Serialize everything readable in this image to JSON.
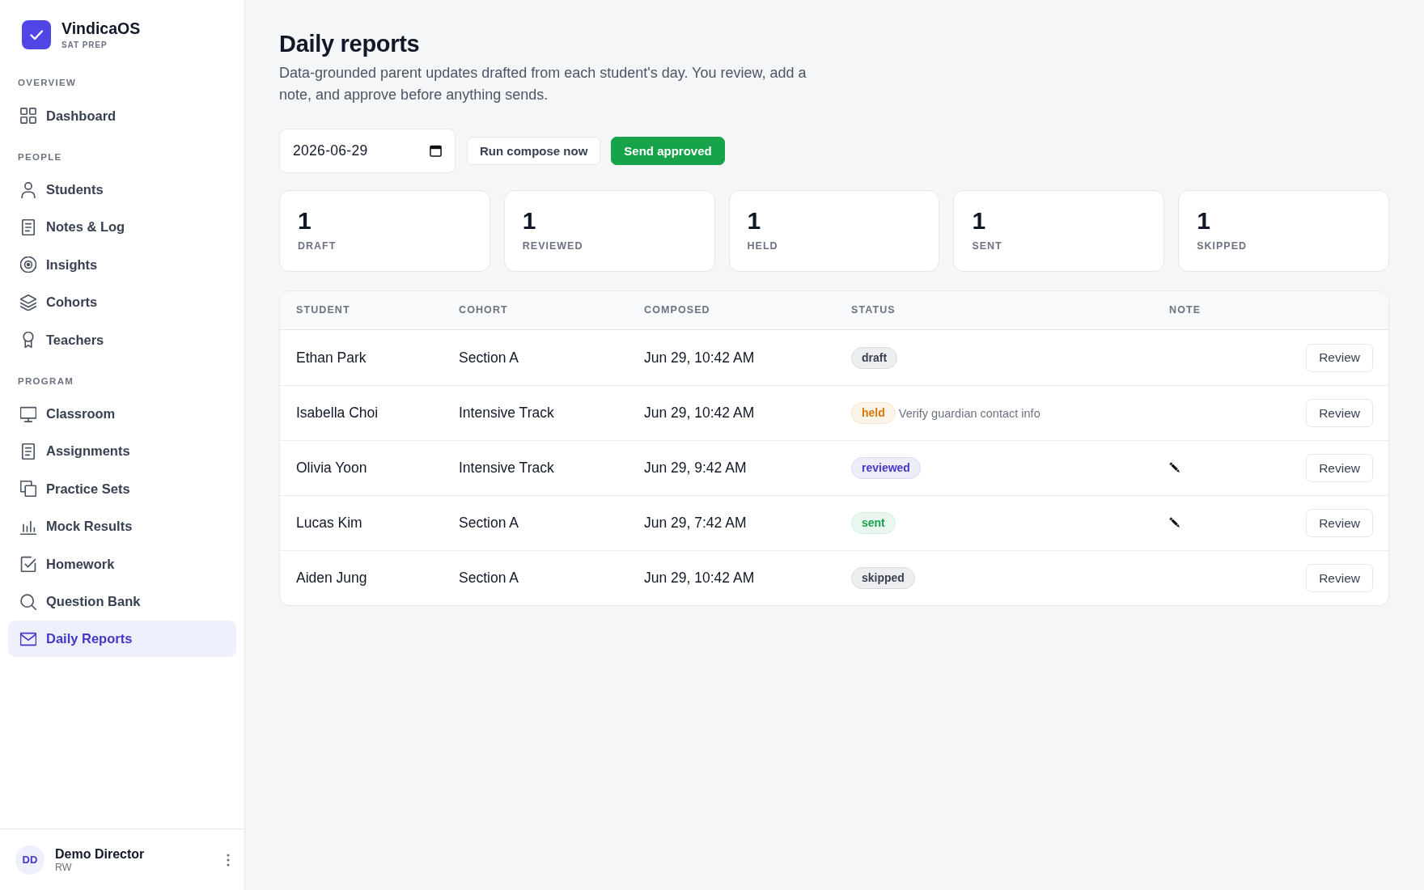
{
  "brand": {
    "name": "VindicaOS",
    "tagline": "SAT PREP"
  },
  "sidebar": {
    "sections": [
      {
        "title": "OVERVIEW",
        "items": [
          {
            "label": "Dashboard",
            "selected": false
          }
        ]
      },
      {
        "title": "PEOPLE",
        "items": [
          {
            "label": "Students",
            "selected": false
          },
          {
            "label": "Notes & Log",
            "selected": false
          },
          {
            "label": "Insights",
            "selected": false
          },
          {
            "label": "Cohorts",
            "selected": false
          },
          {
            "label": "Teachers",
            "selected": false
          }
        ]
      },
      {
        "title": "PROGRAM",
        "items": [
          {
            "label": "Classroom",
            "selected": false
          },
          {
            "label": "Assignments",
            "selected": false
          },
          {
            "label": "Practice Sets",
            "selected": false
          },
          {
            "label": "Mock Results",
            "selected": false
          },
          {
            "label": "Homework",
            "selected": false
          },
          {
            "label": "Question Bank",
            "selected": false
          },
          {
            "label": "Daily Reports",
            "selected": true
          }
        ]
      }
    ]
  },
  "user": {
    "initials": "DD",
    "name": "Demo Director",
    "role": "RW"
  },
  "page": {
    "title": "Daily reports",
    "description": "Data-grounded parent updates drafted from each student's day. You review, add a note, and approve before anything sends."
  },
  "toolbar": {
    "date_field": {
      "value": "2026-06-29"
    },
    "buttons": [
      {
        "label": "Run compose now",
        "kind": "secondary"
      },
      {
        "label": "Send approved",
        "kind": "primary"
      }
    ]
  },
  "stats": [
    {
      "value": "1",
      "label": "DRAFT"
    },
    {
      "value": "1",
      "label": "REVIEWED"
    },
    {
      "value": "1",
      "label": "HELD"
    },
    {
      "value": "1",
      "label": "SENT"
    },
    {
      "value": "1",
      "label": "SKIPPED"
    }
  ],
  "table": {
    "columns": [
      "STUDENT",
      "COHORT",
      "COMPOSED",
      "STATUS",
      "NOTE"
    ],
    "rows": [
      {
        "student": "Ethan Park",
        "cohort": "Section A",
        "composed": "Jun 29, 10:42 AM",
        "status": {
          "label": "draft",
          "color": "#374151"
        },
        "has_note": false,
        "action": "Review"
      },
      {
        "student": "Isabella Choi",
        "cohort": "Intensive Track",
        "composed": "Jun 29, 10:42 AM",
        "status": {
          "label": "held",
          "color": "#d97706"
        },
        "hold_reason": "Verify guardian contact info",
        "has_note": false,
        "action": "Review"
      },
      {
        "student": "Olivia Yoon",
        "cohort": "Intensive Track",
        "composed": "Jun 29, 9:42 AM",
        "status": {
          "label": "reviewed",
          "color": "#4338ca"
        },
        "has_note": true,
        "action": "Review"
      },
      {
        "student": "Lucas Kim",
        "cohort": "Section A",
        "composed": "Jun 29, 7:42 AM",
        "status": {
          "label": "sent",
          "color": "#16a34a"
        },
        "has_note": true,
        "action": "Review"
      },
      {
        "student": "Aiden Jung",
        "cohort": "Section A",
        "composed": "Jun 29, 10:42 AM",
        "status": {
          "label": "skipped",
          "color": "#374151"
        },
        "has_note": false,
        "action": "Review"
      }
    ]
  }
}
